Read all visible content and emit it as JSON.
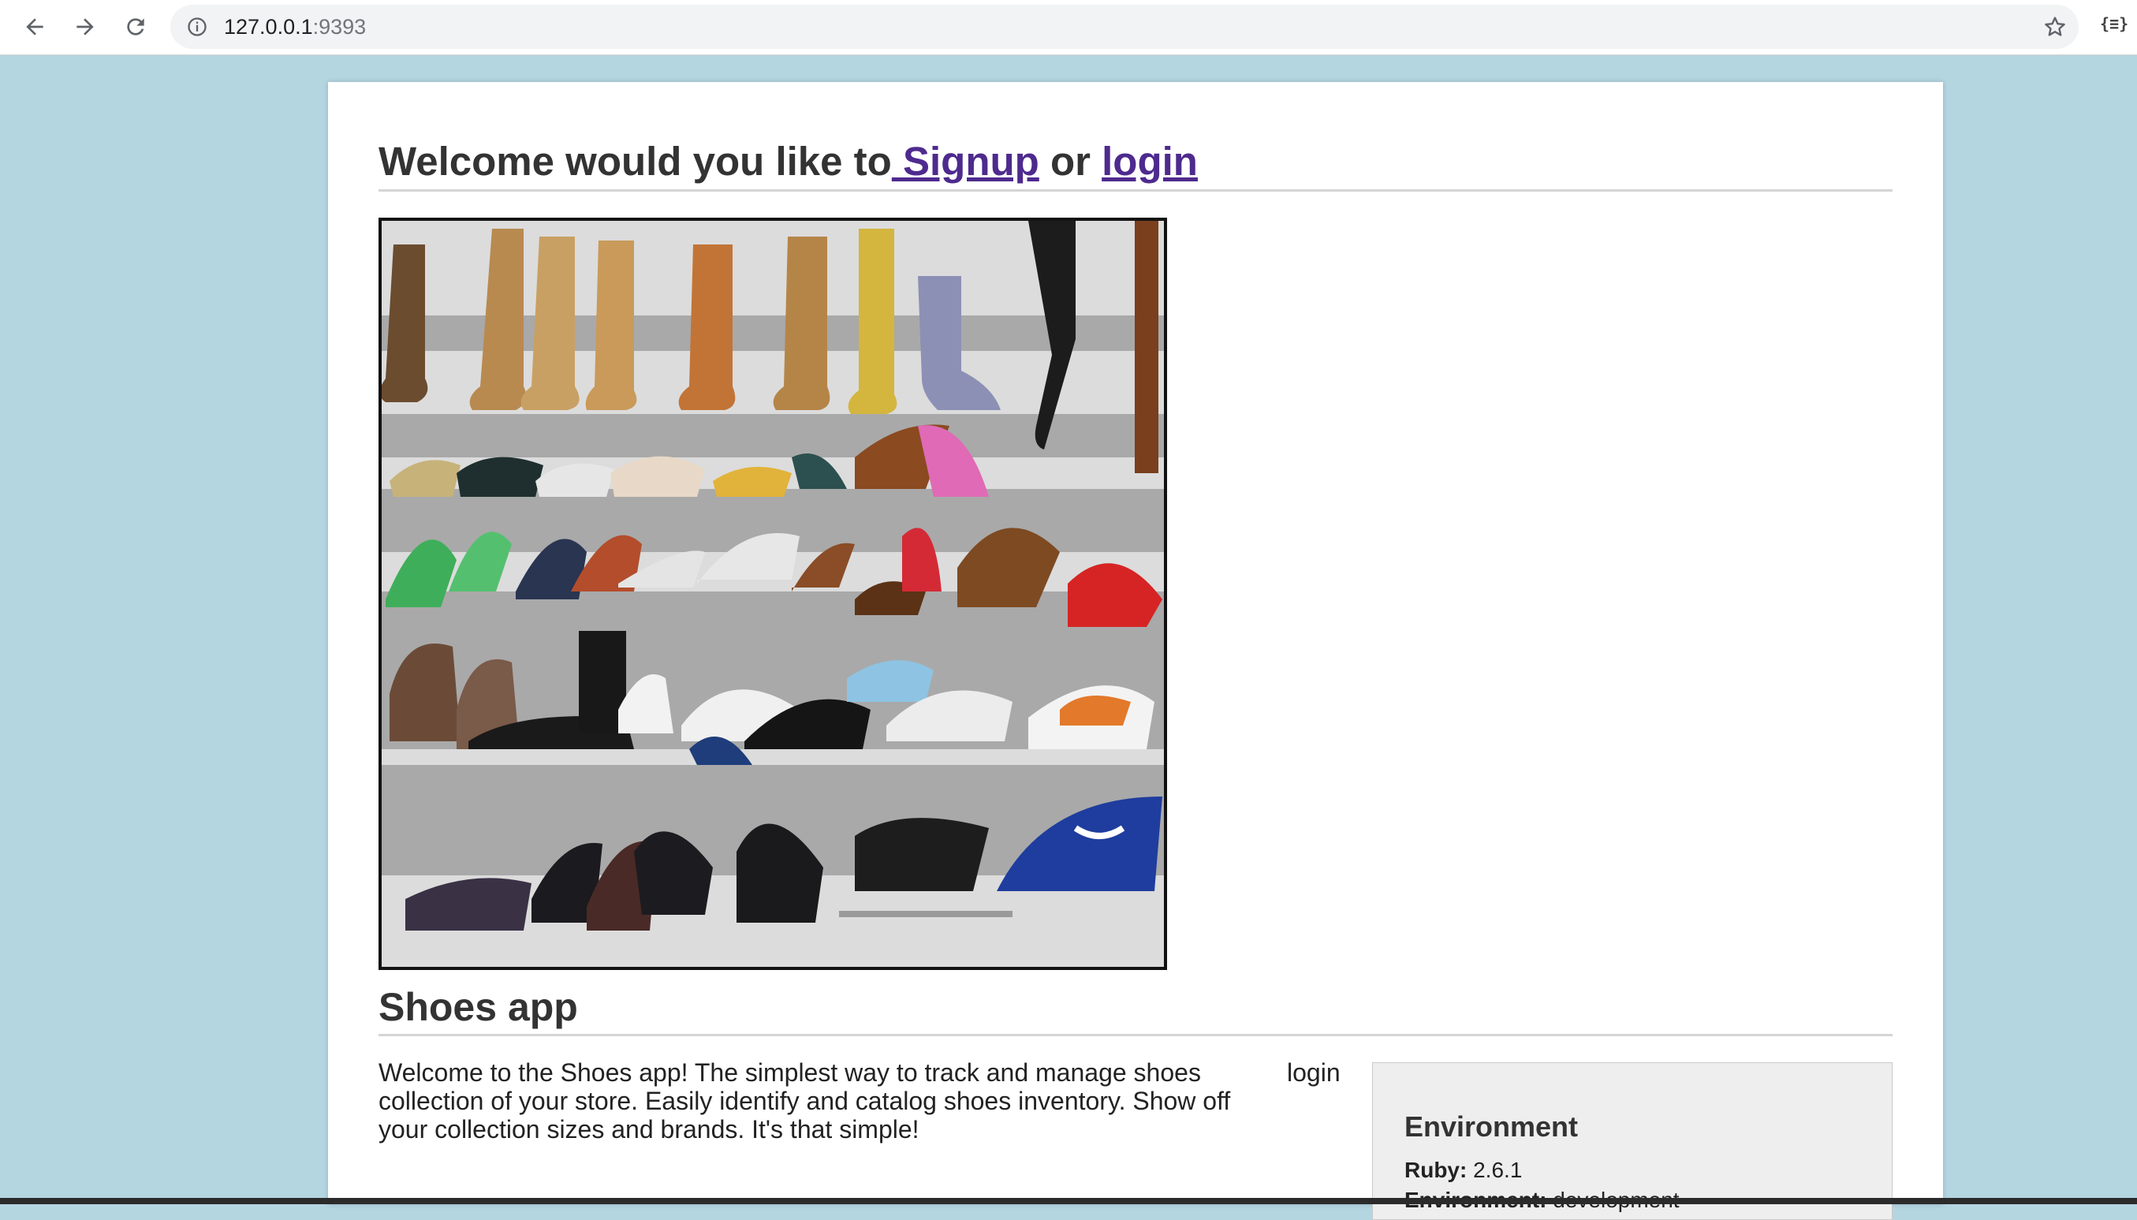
{
  "browser": {
    "url_host": "127.0.0.1",
    "url_port": ":9393",
    "icons": [
      "back-icon",
      "forward-icon",
      "reload-icon",
      "info-icon",
      "star-icon",
      "json-viewer-icon"
    ],
    "extension_label": "{≡}"
  },
  "header": {
    "prefix": "Welcome would you like to",
    "signup_label": " Signup",
    "or_text": " or ",
    "login_label": "login"
  },
  "hero_image": {
    "alt": "shoes",
    "description_icon": "shoes-collage-image"
  },
  "app": {
    "title": "Shoes app",
    "intro": "Welcome to the Shoes app! The simplest way to track and manage shoes collection of your store. Easily identify and catalog shoes inventory. Show off your collection sizes and brands. It's that simple!",
    "side_login": "login"
  },
  "environment": {
    "title": "Environment",
    "ruby_label": "Ruby:",
    "ruby_value": "2.6.1",
    "env_label": "Environment:",
    "env_value": "development"
  },
  "colors": {
    "page_bg": "#b4d6e1",
    "link": "#4e2a8e",
    "card_bg": "#ffffff"
  }
}
